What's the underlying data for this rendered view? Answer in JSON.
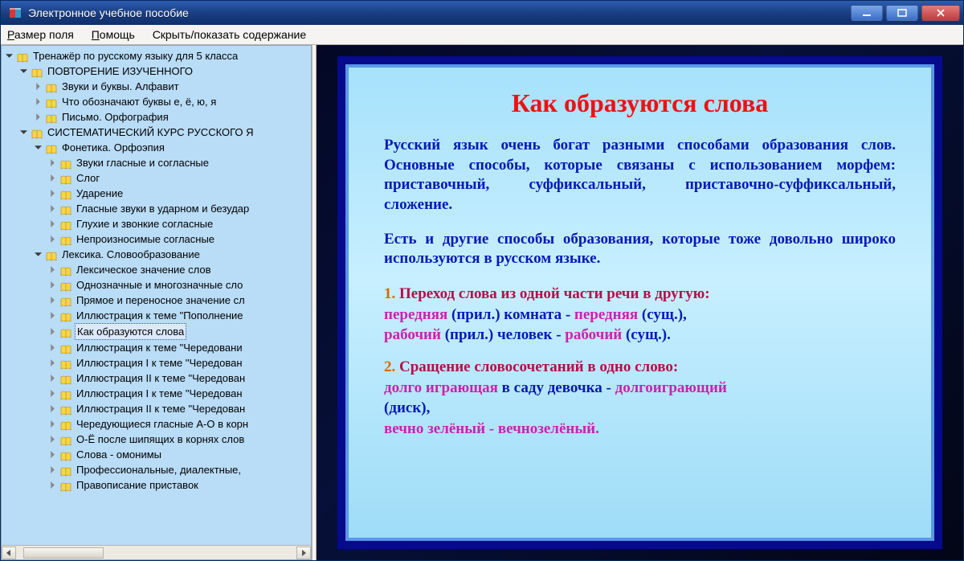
{
  "window": {
    "title": "Электронное учебное пособие"
  },
  "menu": {
    "size": "Размер поля",
    "help": "Помощь",
    "toggle": "Скрыть/показать содержание"
  },
  "tree": {
    "root": "Тренажёр по русскому языку для 5 класса",
    "s1": {
      "title": "ПОВТОРЕНИЕ ИЗУЧЕННОГО",
      "items": [
        "Звуки и буквы. Алфавит",
        "Что обозначают буквы е, ё, ю, я",
        "Письмо. Орфография"
      ]
    },
    "s2": {
      "title": "СИСТЕМАТИЧЕСКИЙ КУРС РУССКОГО Я",
      "phon": {
        "title": "Фонетика. Орфоэпия",
        "items": [
          "Звуки гласные и согласные",
          "Слог",
          "Ударение",
          "Гласные звуки в ударном и безудар",
          "Глухие и звонкие согласные",
          "Непроизносимые согласные"
        ]
      },
      "lex": {
        "title": "Лексика. Словообразование",
        "items": [
          "Лексическое значение слов",
          "Однозначные и многозначные сло",
          "Прямое и переносное значение сл",
          "Иллюстрация к теме \"Пополнение",
          "Как образуются слова",
          "Иллюстрация к теме \"Чередовани",
          "Иллюстрация I к теме \"Чередован",
          "Иллюстрация II к теме \"Чередован",
          "Иллюстрация I к теме \"Чередован",
          "Иллюстрация II к теме \"Чередован",
          "Чередующиеся гласные А-О в корн",
          "О-Ё после шипящих в корнях слов",
          "Слова - омонимы",
          "Профессиональные, диалектные,",
          "Правописание приставок"
        ]
      }
    }
  },
  "slide": {
    "title": "Как образуются слова",
    "p1": "Русский язык очень богат разными способами образования слов. Основные способы, которые связаны с использованием морфем: приставочный, суффиксальный, приставочно-суффиксальный, сложение.",
    "p2": "Есть и другие способы образования, которые тоже довольно широко используются в русском языке.",
    "ex1_n": "1.",
    "ex1_h": " Переход слова из одной части речи в другую:",
    "ex1_a": "передняя",
    "ex1_b": " (прил.) комната - ",
    "ex1_c": "передняя",
    "ex1_d": " (сущ.),",
    "ex1_e": "рабочий",
    "ex1_f": " (прил.) человек - ",
    "ex1_g": "рабочий",
    "ex1_h2": " (сущ.).",
    "ex2_n": "2.",
    "ex2_h": " Сращение словосочетаний в одно слово:",
    "ex2_a": "долго играющая",
    "ex2_b": " в саду девочка - ",
    "ex2_c": "долгоиграющий",
    "ex2_d": "(диск),",
    "ex2_e": "вечно зелёный - вечнозелёный."
  }
}
